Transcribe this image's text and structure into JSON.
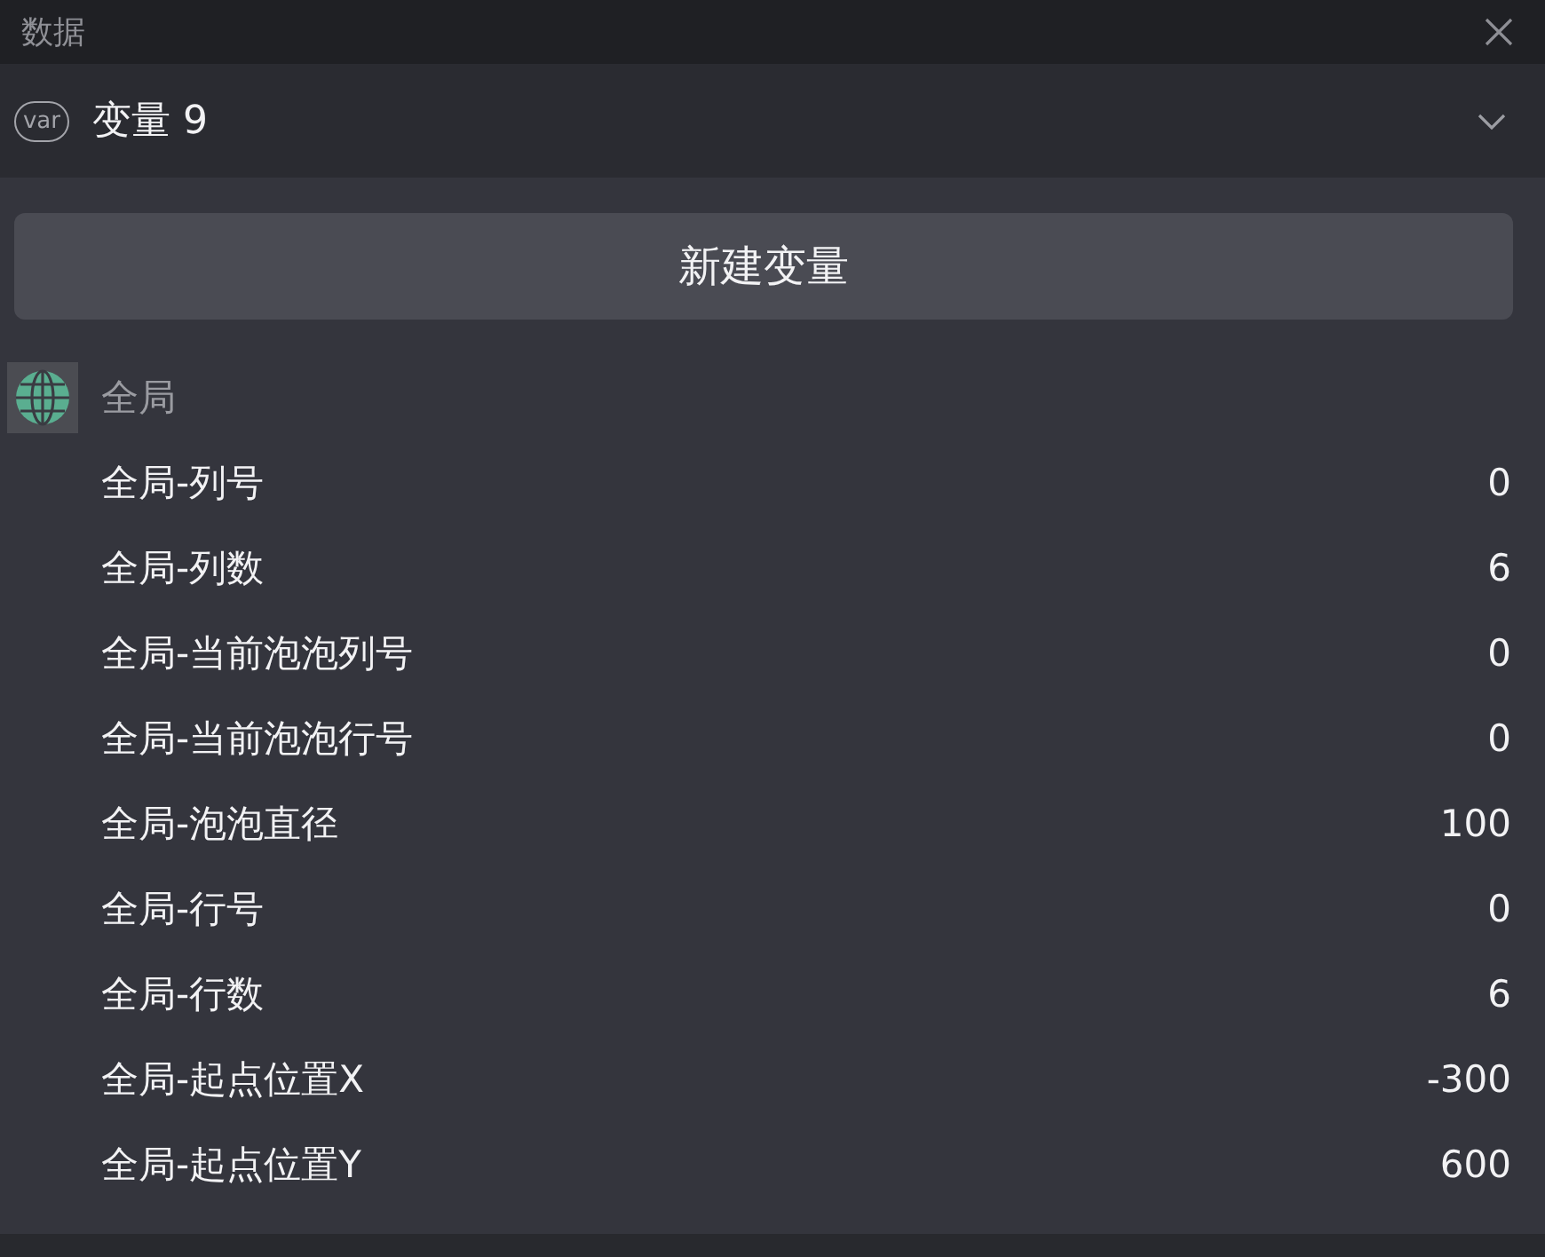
{
  "panel": {
    "title": "数据"
  },
  "variable_select": {
    "badge": "var",
    "value": "变量 9",
    "expanded": false
  },
  "new_button": {
    "label": "新建变量"
  },
  "groups": [
    {
      "label": "全局",
      "variables": [
        {
          "name": "全局-列号",
          "value": "0"
        },
        {
          "name": "全局-列数",
          "value": "6"
        },
        {
          "name": "全局-当前泡泡列号",
          "value": "0"
        },
        {
          "name": "全局-当前泡泡行号",
          "value": "0"
        },
        {
          "name": "全局-泡泡直径",
          "value": "100"
        },
        {
          "name": "全局-行号",
          "value": "0"
        },
        {
          "name": "全局-行数",
          "value": "6"
        },
        {
          "name": "全局-起点位置X",
          "value": "-300"
        },
        {
          "name": "全局-起点位置Y",
          "value": "600"
        }
      ]
    }
  ]
}
